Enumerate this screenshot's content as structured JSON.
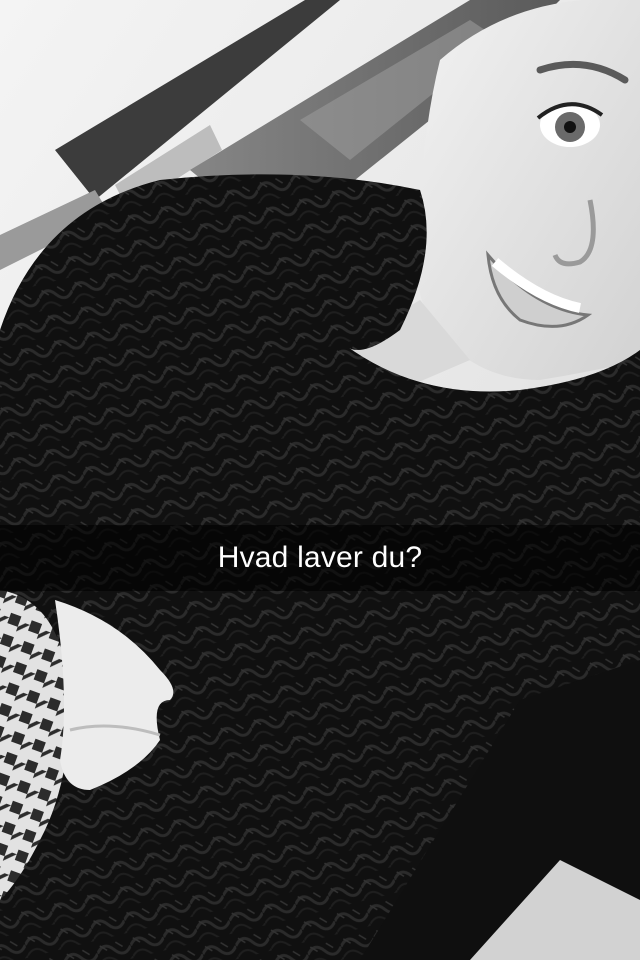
{
  "snap": {
    "caption": "Hvad laver du?",
    "caption_color": "#ffffff",
    "caption_bar_color": "rgba(0,0,0,0.58)",
    "image_mode": "grayscale"
  }
}
